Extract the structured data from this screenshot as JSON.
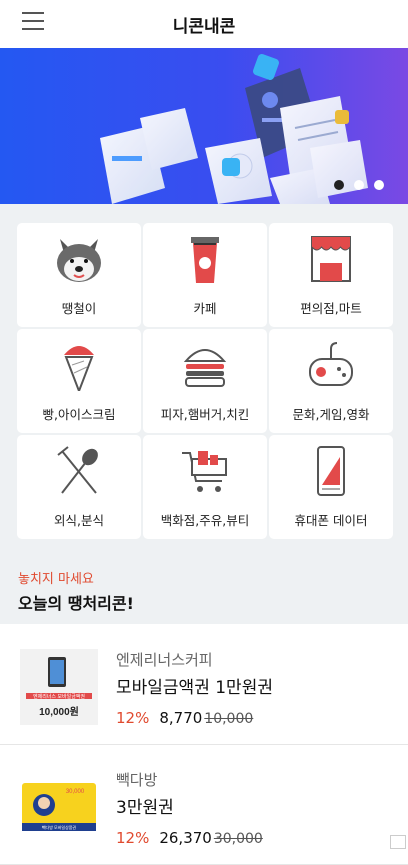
{
  "header": {
    "title": "니콘내콘",
    "menu_icon": "hamburger-menu-icon"
  },
  "banner": {
    "slide_count": 3,
    "active_slide": 1
  },
  "categories": [
    {
      "label": "땡철이",
      "icon": "dog-mascot-icon"
    },
    {
      "label": "카페",
      "icon": "coffee-cup-icon"
    },
    {
      "label": "편의점,마트",
      "icon": "store-icon"
    },
    {
      "label": "빵,아이스크림",
      "icon": "ice-cream-cone-icon"
    },
    {
      "label": "피자,햄버거,치킨",
      "icon": "burger-icon"
    },
    {
      "label": "문화,게임,영화",
      "icon": "game-controller-icon"
    },
    {
      "label": "외식,분식",
      "icon": "fork-spoon-icon"
    },
    {
      "label": "백화점,주유,뷰티",
      "icon": "shopping-cart-icon"
    },
    {
      "label": "휴대폰 데이터",
      "icon": "mobile-phone-icon"
    }
  ],
  "promo": {
    "subtitle": "놓치지 마세요",
    "title": "오늘의 땡처리콘!"
  },
  "deals": [
    {
      "brand": "엔제리너스커피",
      "name": "모바일금액권 1만원권",
      "discount": "12%",
      "price": "8,770",
      "original": "10,000",
      "thumb_text": "10,000원",
      "thumb_small": "엔제리너스 모바일금액권"
    },
    {
      "brand": "빽다방",
      "name": "3만원권",
      "discount": "12%",
      "price": "26,370",
      "original": "30,000",
      "thumb_text": "30,000",
      "thumb_small": "빽다방 모바일상품권"
    }
  ],
  "colors": {
    "accent": "#e04a2f",
    "banner_start": "#2458f2",
    "banner_end": "#7a49e4",
    "section_bg": "#eef1f3"
  }
}
